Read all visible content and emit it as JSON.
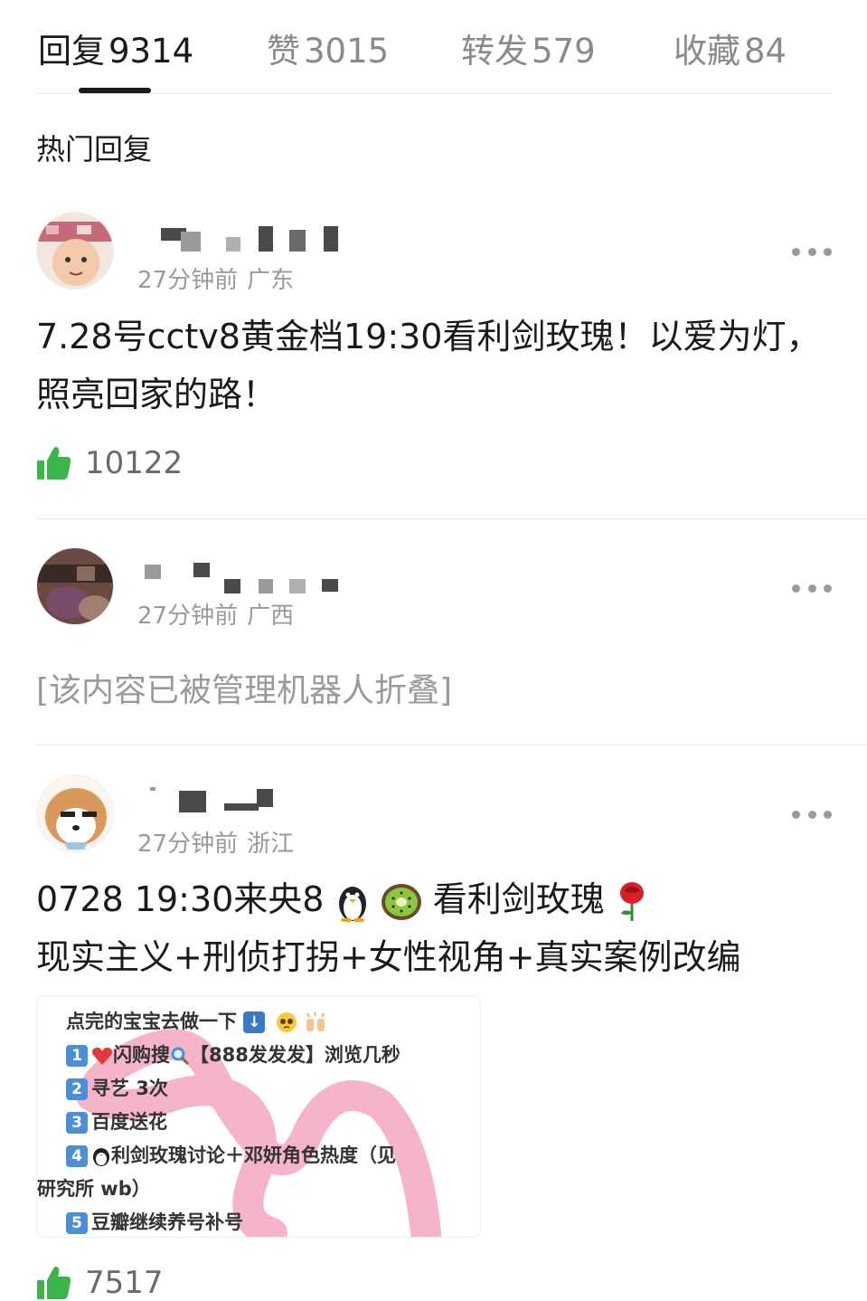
{
  "tabs": [
    {
      "label": "回复",
      "count": "9314"
    },
    {
      "label": "赞",
      "count": "3015"
    },
    {
      "label": "转发",
      "count": "579"
    },
    {
      "label": "收藏",
      "count": "84"
    }
  ],
  "section_title": "热门回复",
  "comments": [
    {
      "time": "27分钟前",
      "location": "广东",
      "content": "7.28号cctv8黄金档19:30看利剑玫瑰！以爱为灯，照亮回家的路！",
      "likes": "10122"
    },
    {
      "time": "27分钟前",
      "location": "广西",
      "content": "[该内容已被管理机器人折叠]"
    },
    {
      "time": "27分钟前",
      "location": "浙江",
      "line1_a": "0728 19:30来央8",
      "line1_b": "看利剑玫瑰",
      "line2": "现实主义+刑侦打拐+女性视角+真实案例改编",
      "likes": "7517",
      "card": {
        "intro": "点完的宝宝去做一下",
        "item1_a": "闪购搜",
        "item1_b": "【888发发发】浏览几秒",
        "item2": "寻艺 3次",
        "item3": "百度送花",
        "item4_a": "利剑玫瑰讨论＋邓妍角色热度（见",
        "item4_b": "研究所 wb）",
        "item5": "豆瓣继续养号补号",
        "nums": [
          "1",
          "2",
          "3",
          "4",
          "5"
        ]
      }
    }
  ],
  "colors": {
    "like_green": "#3bb54a",
    "scribble_pink": "#f4a7c0",
    "num_badge_blue": "#4a8fd8"
  }
}
